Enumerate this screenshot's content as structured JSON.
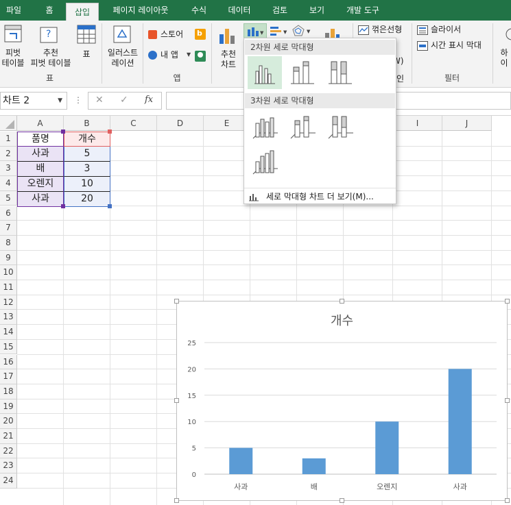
{
  "ribbon_tabs": [
    "파일",
    "홈",
    "삽입",
    "페이지 레이아웃",
    "수식",
    "데이터",
    "검토",
    "보기",
    "개발 도구"
  ],
  "ribbon": {
    "pivot_table": "피벗\n테이블",
    "recommended_pivot": "추천\n피벗 테이블",
    "table": "표",
    "group_tables": "표",
    "illustrations": "일러스트\n레이션",
    "store": "스토어",
    "my_apps": "내 앱",
    "group_apps": "앱",
    "recommended_charts": "추천\n차트",
    "line_spark": "꺾은선형",
    "slicer": "슬라이서",
    "timeline": "시간 표시 막대",
    "group_filters": "필터",
    "hyperlink_partial": "하이",
    "partial_w": "W)",
    "partial_in": "인"
  },
  "formula_bar": {
    "name_box": "차트 2",
    "cancel_icon": "✕",
    "enter_icon": "✓",
    "fx_icon": "fx",
    "formula": ""
  },
  "columns": [
    "A",
    "B",
    "C",
    "D",
    "E",
    "F",
    "G",
    "H",
    "I",
    "J"
  ],
  "rows": [
    "1",
    "2",
    "3",
    "4",
    "5",
    "6",
    "7",
    "8",
    "9",
    "10",
    "11",
    "12",
    "13",
    "14",
    "15",
    "16",
    "17",
    "18",
    "19",
    "20",
    "21",
    "22",
    "23",
    "24"
  ],
  "table": {
    "headers": [
      "품명",
      "개수"
    ],
    "rows": [
      [
        "사과",
        "5"
      ],
      [
        "배",
        "3"
      ],
      [
        "오렌지",
        "10"
      ],
      [
        "사과",
        "20"
      ]
    ]
  },
  "dropdown": {
    "section_2d": "2차원 세로 막대형",
    "section_3d": "3차원 세로 막대형",
    "more": "세로 막대형 차트 더 보기(M)..."
  },
  "chart_data": {
    "type": "bar",
    "title": "개수",
    "categories": [
      "사과",
      "배",
      "오렌지",
      "사과"
    ],
    "values": [
      5,
      3,
      10,
      20
    ],
    "ylim": [
      0,
      25
    ],
    "yticks": [
      "0",
      "5",
      "10",
      "15",
      "20",
      "25"
    ],
    "grid": true,
    "bar_color": "#5b9bd5"
  },
  "colors": {
    "excel_green": "#217346",
    "header_purple": "#7030a0",
    "header_red": "#e06060",
    "data_blue": "#4472c4"
  }
}
